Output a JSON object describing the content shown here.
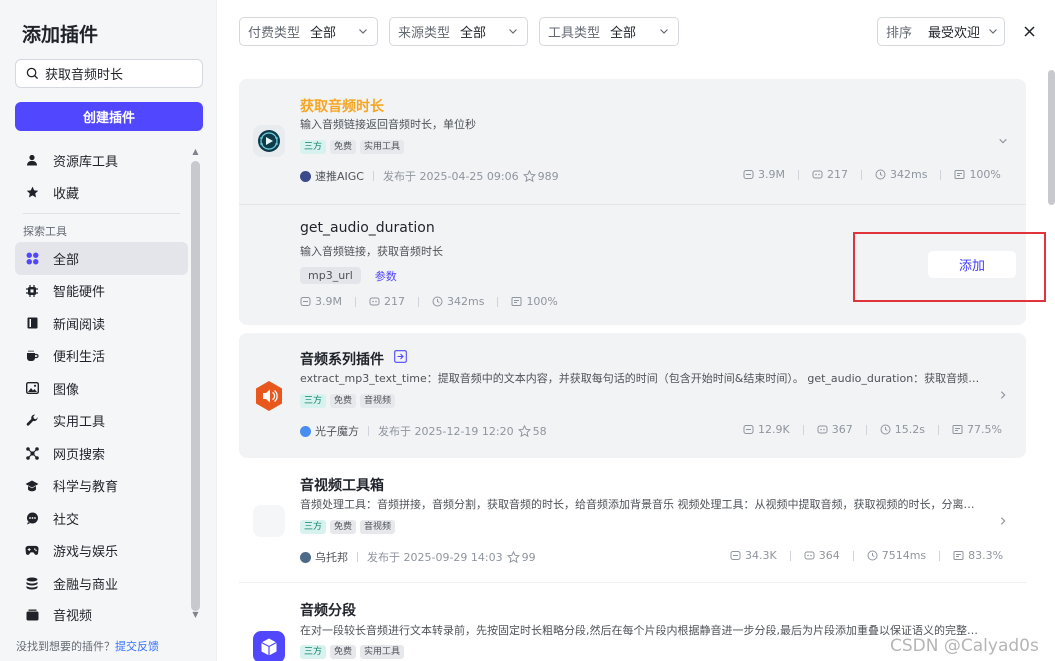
{
  "sidebar": {
    "title": "添加插件",
    "search_value": "获取音频时长",
    "create_label": "创建插件",
    "top_items": [
      {
        "label": "资源库工具",
        "icon": "user-icon"
      },
      {
        "label": "收藏",
        "icon": "star-icon"
      }
    ],
    "section_label": "探索工具",
    "items": [
      {
        "label": "全部",
        "icon": "grid-icon",
        "active": true
      },
      {
        "label": "智能硬件",
        "icon": "chip-icon"
      },
      {
        "label": "新闻阅读",
        "icon": "book-icon"
      },
      {
        "label": "便利生活",
        "icon": "cup-icon"
      },
      {
        "label": "图像",
        "icon": "image-icon"
      },
      {
        "label": "实用工具",
        "icon": "wrench-icon"
      },
      {
        "label": "网页搜索",
        "icon": "network-icon"
      },
      {
        "label": "科学与教育",
        "icon": "graduation-cap-icon"
      },
      {
        "label": "社交",
        "icon": "chat-icon"
      },
      {
        "label": "游戏与娱乐",
        "icon": "gamepad-icon"
      },
      {
        "label": "金融与商业",
        "icon": "coins-icon"
      },
      {
        "label": "音视频",
        "icon": "media-icon"
      }
    ],
    "footer_text": "没找到想要的插件？",
    "footer_link": "提交反馈"
  },
  "filters": {
    "pay": {
      "label": "付费类型",
      "value": "全部"
    },
    "source": {
      "label": "来源类型",
      "value": "全部"
    },
    "tool": {
      "label": "工具类型",
      "value": "全部"
    },
    "sort": {
      "label": "排序",
      "value": "最受欢迎"
    }
  },
  "cards": [
    {
      "title": "获取音频时长",
      "desc": "输入音频链接返回音频时长，单位秒",
      "tags": [
        "三方",
        "免费",
        "实用工具"
      ],
      "author": "速推AIGC",
      "published": "发布于 2025-04-25 09:06",
      "favorites": "989",
      "calls": "3.9M",
      "bots": "217",
      "latency": "342ms",
      "success": "100%",
      "sub": {
        "name": "get_audio_duration",
        "desc": "输入音频链接，获取音频时长",
        "param_chip": "mp3_url",
        "param_label": "参数",
        "calls": "3.9M",
        "bots": "217",
        "latency": "342ms",
        "success": "100%",
        "add_label": "添加"
      }
    },
    {
      "title": "音频系列插件",
      "desc": "extract_mp3_text_time：提取音频中的文本内容，并获取每句话的时间（包含开始时间&结束时间）。 get_audio_duration：获取音频文…",
      "tags": [
        "三方",
        "免费",
        "音视频"
      ],
      "author": "光子魔方",
      "published": "发布于 2025-12-19 12:20",
      "favorites": "58",
      "calls": "12.9K",
      "bots": "367",
      "latency": "15.2s",
      "success": "77.5%"
    },
    {
      "title": "音视频工具箱",
      "desc": "音频处理工具：音频拼接，音频分割，获取音频的时长，给音频添加背景音乐 视频处理工具：从视频中提取音频，获取视频的时长，分离…",
      "tags": [
        "三方",
        "免费",
        "音视频"
      ],
      "author": "乌托邦",
      "published": "发布于 2025-09-29 14:03",
      "favorites": "99",
      "calls": "34.3K",
      "bots": "364",
      "latency": "7514ms",
      "success": "83.3%"
    },
    {
      "title": "音频分段",
      "desc": "在对一段较长音频进行文本转录前，先按固定时长粗略分段,然后在每个片段内根据静音进一步分段,最后为片段添加重叠以保证语义的完整…",
      "tags": [
        "三方",
        "免费",
        "实用工具"
      ]
    }
  ],
  "watermark": "CSDN @Calyad0s",
  "colors": {
    "accent": "#5147ff",
    "title_orange": "#f5a623",
    "highlight_red": "#e0333b",
    "sidebar_bg": "#f5f6f8"
  }
}
